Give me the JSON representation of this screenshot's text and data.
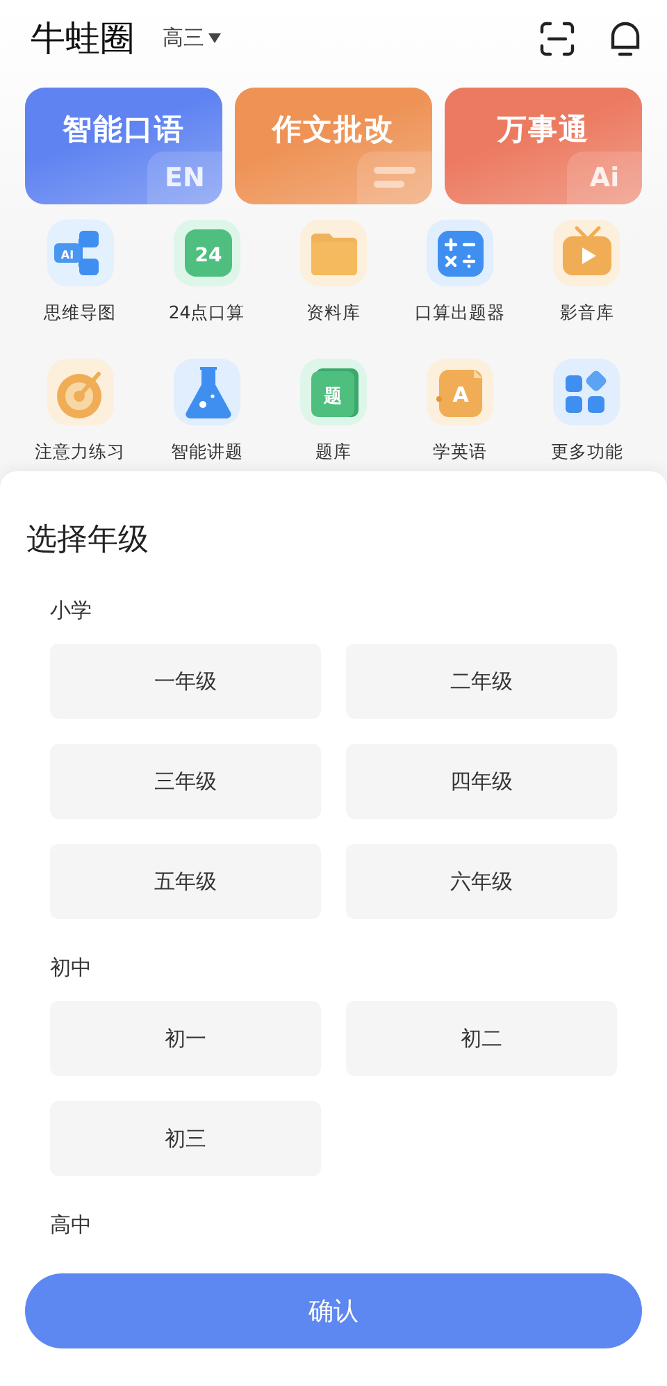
{
  "header": {
    "title": "牛蛙圈",
    "grade": "高三"
  },
  "feature_cards": [
    {
      "label": "智能口语",
      "badge": "EN",
      "color": "#5f83f1"
    },
    {
      "label": "作文批改",
      "color": "#ee9255"
    },
    {
      "label": "万事通",
      "badge": "Ai",
      "color": "#ec7a60"
    }
  ],
  "tools": [
    {
      "label": "思维导图",
      "icon_text": "AI"
    },
    {
      "label": "24点口算",
      "icon_text": "24"
    },
    {
      "label": "资料库"
    },
    {
      "label": "口算出题器"
    },
    {
      "label": "影音库"
    },
    {
      "label": "注意力练习"
    },
    {
      "label": "智能讲题"
    },
    {
      "label": "题库",
      "icon_text": "题"
    },
    {
      "label": "学英语",
      "icon_text": "A"
    },
    {
      "label": "更多功能"
    }
  ],
  "grade_sheet": {
    "title": "选择年级",
    "sections": [
      {
        "title": "小学",
        "options": [
          {
            "label": "一年级",
            "selected": false
          },
          {
            "label": "二年级",
            "selected": false
          },
          {
            "label": "三年级",
            "selected": false
          },
          {
            "label": "四年级",
            "selected": false
          },
          {
            "label": "五年级",
            "selected": false
          },
          {
            "label": "六年级",
            "selected": false
          }
        ]
      },
      {
        "title": "初中",
        "options": [
          {
            "label": "初一",
            "selected": false
          },
          {
            "label": "初二",
            "selected": false
          },
          {
            "label": "初三",
            "selected": false
          }
        ]
      },
      {
        "title": "高中"
      }
    ],
    "confirm": "确认"
  }
}
